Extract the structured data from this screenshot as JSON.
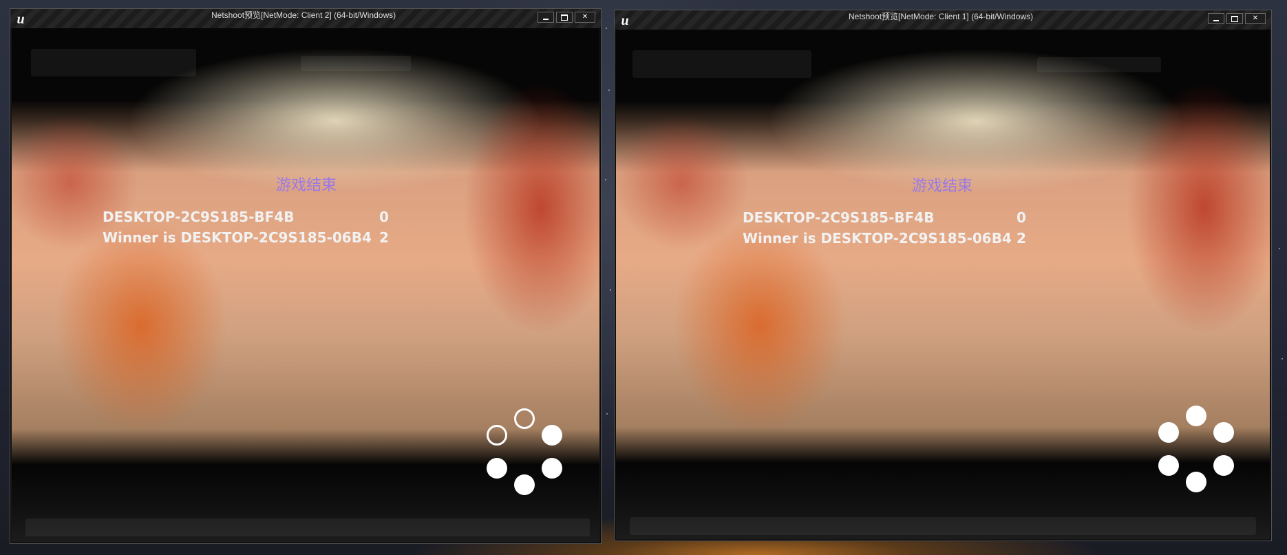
{
  "windows": [
    {
      "title": "Netshoot预览[NetMode: Client 2] (64-bit/Windows)",
      "game_over_title": "游戏结束",
      "scores": [
        {
          "name": "DESKTOP-2C9S185-BF4B",
          "score": "0"
        },
        {
          "name": "Winner is DESKTOP-2C9S185-06B4",
          "score": "2"
        }
      ]
    },
    {
      "title": "Netshoot预览[NetMode: Client 1] (64-bit/Windows)",
      "game_over_title": "游戏结束",
      "scores": [
        {
          "name": "DESKTOP-2C9S185-BF4B",
          "score": "0"
        },
        {
          "name": "Winner is DESKTOP-2C9S185-06B4",
          "score": "2"
        }
      ]
    }
  ],
  "window_controls": {
    "minimize": "",
    "maximize": "",
    "close": "✕"
  },
  "logo_text": "u"
}
